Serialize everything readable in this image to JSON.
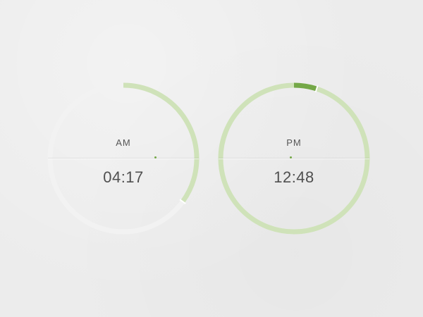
{
  "colors": {
    "background": "#ececec",
    "track_light": "#f2f2f2",
    "ring_green": "#cfe2b9",
    "accent_green": "#74a847",
    "marker_white": "#ffffff",
    "text": "#4f4f4f"
  },
  "clocks": [
    {
      "id": "am",
      "meridiem": "AM",
      "time": "04:17",
      "progress_fraction": 0.35,
      "highlight_fraction": 0.0
    },
    {
      "id": "pm",
      "meridiem": "PM",
      "time": "12:48",
      "progress_fraction": 1.0,
      "highlight_fraction": 0.05
    }
  ]
}
